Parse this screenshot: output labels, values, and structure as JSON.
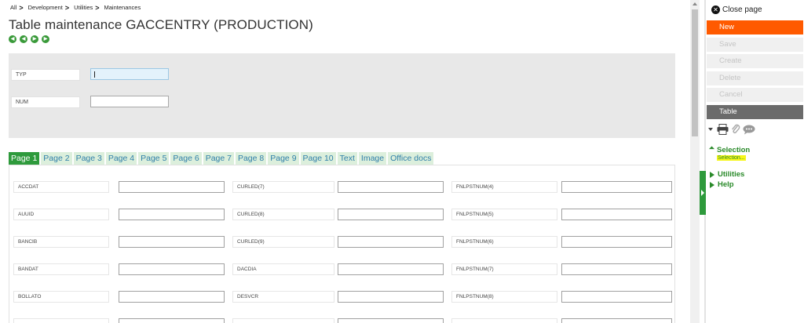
{
  "breadcrumb": [
    {
      "label": "All"
    },
    {
      "label": "Development"
    },
    {
      "label": "Utilities"
    },
    {
      "label": "Maintenances"
    }
  ],
  "page_title": "Table maintenance GACCENTRY (PRODUCTION)",
  "nav_icons": [
    "first-record-icon",
    "previous-record-icon",
    "next-record-icon",
    "last-record-icon"
  ],
  "header_fields": {
    "typ": {
      "label": "TYP",
      "value": ""
    },
    "num": {
      "label": "NUM",
      "value": ""
    }
  },
  "tabs": [
    "Page 1",
    "Page 2",
    "Page 3",
    "Page 4",
    "Page 5",
    "Page 6",
    "Page 7",
    "Page 8",
    "Page 9",
    "Page 10",
    "Text",
    "Image",
    "Office docs"
  ],
  "active_tab": "Page 1",
  "grid": {
    "col1": [
      "ACCDAT",
      "AUUID",
      "BANCIB",
      "BANDAT",
      "BOLLATO"
    ],
    "col2": [
      "CURLED(7)",
      "CURLED(8)",
      "CURLED(9)",
      "DACDIA",
      "DESVCR"
    ],
    "col3": [
      "FNLPSTNUM(4)",
      "FNLPSTNUM(5)",
      "FNLPSTNUM(6)",
      "FNLPSTNUM(7)",
      "FNLPSTNUM(8)"
    ]
  },
  "sidebar": {
    "close_label": "Close page",
    "buttons": {
      "new": "New",
      "save": "Save",
      "create": "Create",
      "delete": "Delete",
      "cancel": "Cancel",
      "table": "Table"
    },
    "sections": {
      "selection": "Selection",
      "selection_link": "Selection...",
      "utilities": "Utilities",
      "help": "Help"
    }
  },
  "colors": {
    "accent_green": "#2e9a3c",
    "new_button": "#ff5a00",
    "table_button": "#6b6b6b",
    "highlight": "#f7f71a"
  }
}
